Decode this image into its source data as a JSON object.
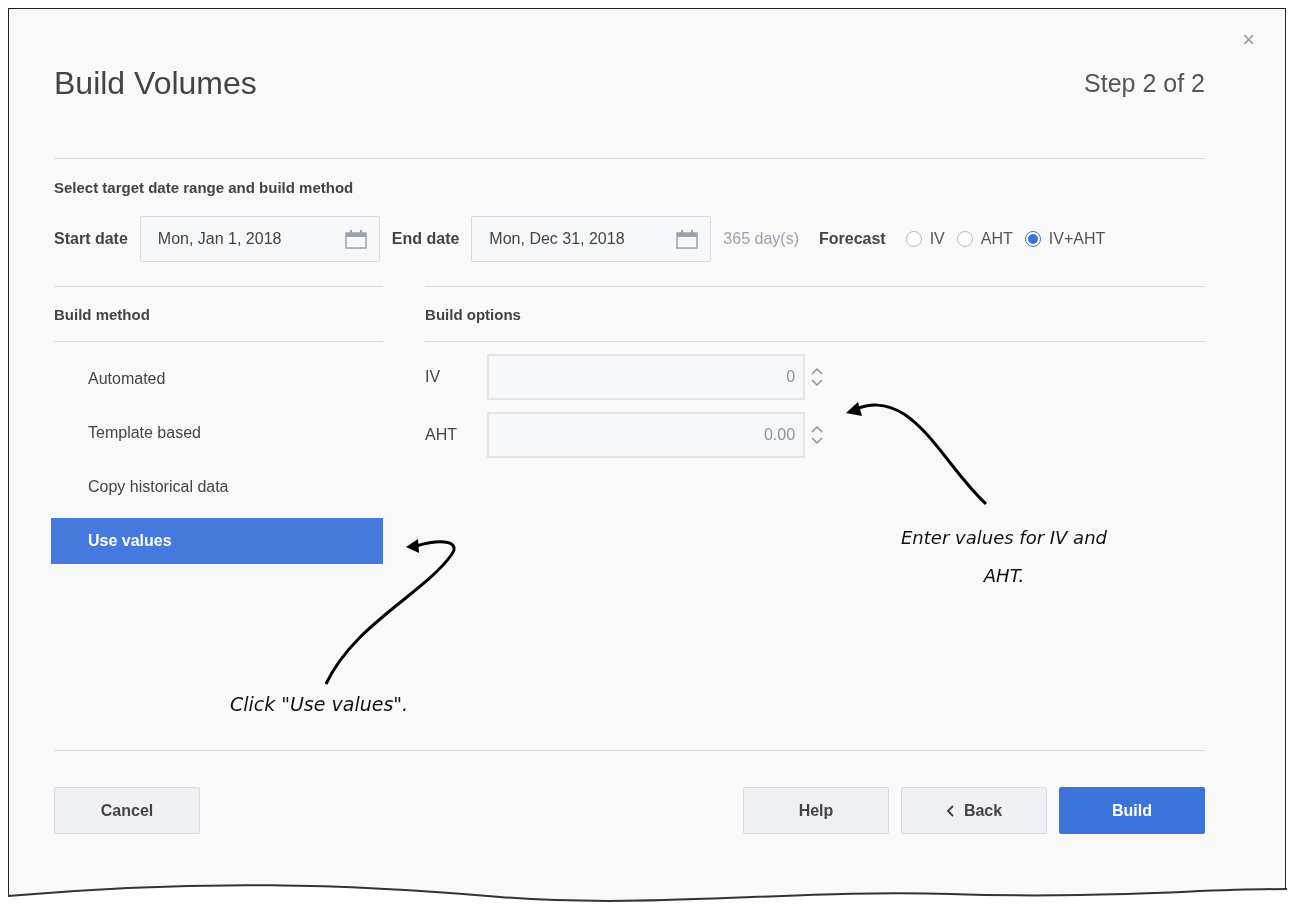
{
  "dialog": {
    "title": "Build Volumes",
    "step": "Step 2 of 2",
    "close": "×"
  },
  "range": {
    "heading": "Select target date range and build method",
    "start_label": "Start date",
    "start_value": "Mon, Jan 1, 2018",
    "end_label": "End date",
    "end_value": "Mon, Dec 31, 2018",
    "days": "365 day(s)",
    "forecast_label": "Forecast",
    "forecast_options": [
      {
        "label": "IV",
        "selected": false
      },
      {
        "label": "AHT",
        "selected": false
      },
      {
        "label": "IV+AHT",
        "selected": true
      }
    ]
  },
  "build_method": {
    "heading": "Build method",
    "items": [
      {
        "label": "Automated",
        "selected": false
      },
      {
        "label": "Template based",
        "selected": false
      },
      {
        "label": "Copy historical data",
        "selected": false
      },
      {
        "label": "Use values",
        "selected": true
      }
    ]
  },
  "build_options": {
    "heading": "Build options",
    "fields": [
      {
        "label": "IV",
        "placeholder": "0"
      },
      {
        "label": "AHT",
        "placeholder": "0.00"
      }
    ]
  },
  "annotations": [
    {
      "text": "Click \"Use values\"."
    },
    {
      "text": "Enter values for IV and AHT."
    }
  ],
  "buttons": [
    {
      "label": "Cancel",
      "kind": "secondary"
    },
    {
      "label": "Help",
      "kind": "secondary"
    },
    {
      "label": "Back",
      "kind": "back"
    },
    {
      "label": "Build",
      "kind": "primary"
    }
  ]
}
